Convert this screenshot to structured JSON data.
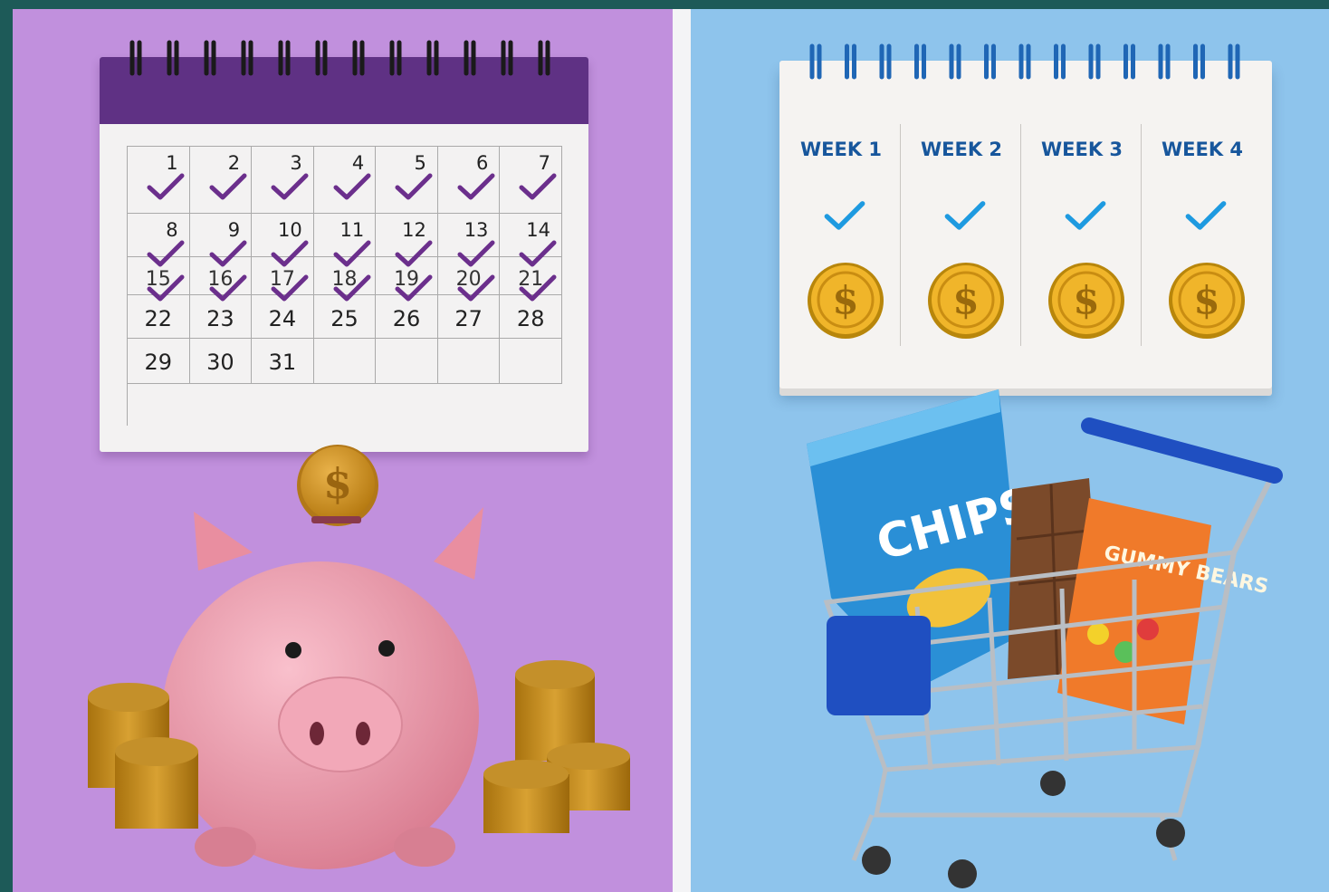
{
  "left_panel": {
    "calendar": {
      "weeks": [
        [
          "1",
          "2",
          "3",
          "4",
          "5",
          "6",
          "7"
        ],
        [
          "8",
          "9",
          "10",
          "11",
          "12",
          "13",
          "14"
        ],
        [
          "15",
          "16",
          "17",
          "18",
          "19",
          "20",
          "21"
        ],
        [
          "22",
          "23",
          "24",
          "25",
          "26",
          "27",
          "28"
        ],
        [
          "29",
          "30",
          "31",
          "",
          "",
          "",
          ""
        ]
      ],
      "checked_days": 21
    },
    "colors": {
      "background": "#c190dd",
      "calendar_header": "#5f3184",
      "check": "#6b2f8c"
    }
  },
  "right_panel": {
    "weeks": [
      "WEEK 1",
      "WEEK 2",
      "WEEK 3",
      "WEEK 4"
    ],
    "coin_symbol": "$",
    "snack_labels": {
      "chips": "CHIPS",
      "gummy": "GUMMY BEARS"
    },
    "colors": {
      "background": "#8ec4ec",
      "week_text": "#17569c",
      "check": "#1e9ae0",
      "cart": "#1f4fc1"
    }
  },
  "icons": [
    "calendar-icon",
    "check-icon",
    "coin-icon",
    "piggy-bank-icon",
    "shopping-cart-icon"
  ]
}
